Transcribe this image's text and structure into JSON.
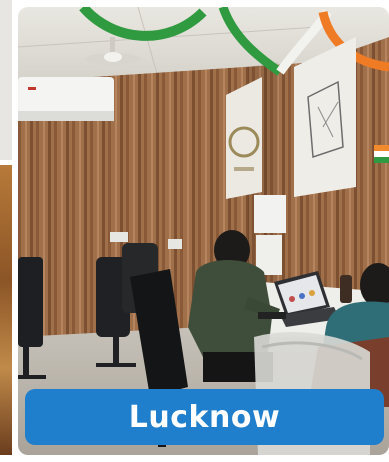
{
  "caption": {
    "label": "Lucknow"
  }
}
